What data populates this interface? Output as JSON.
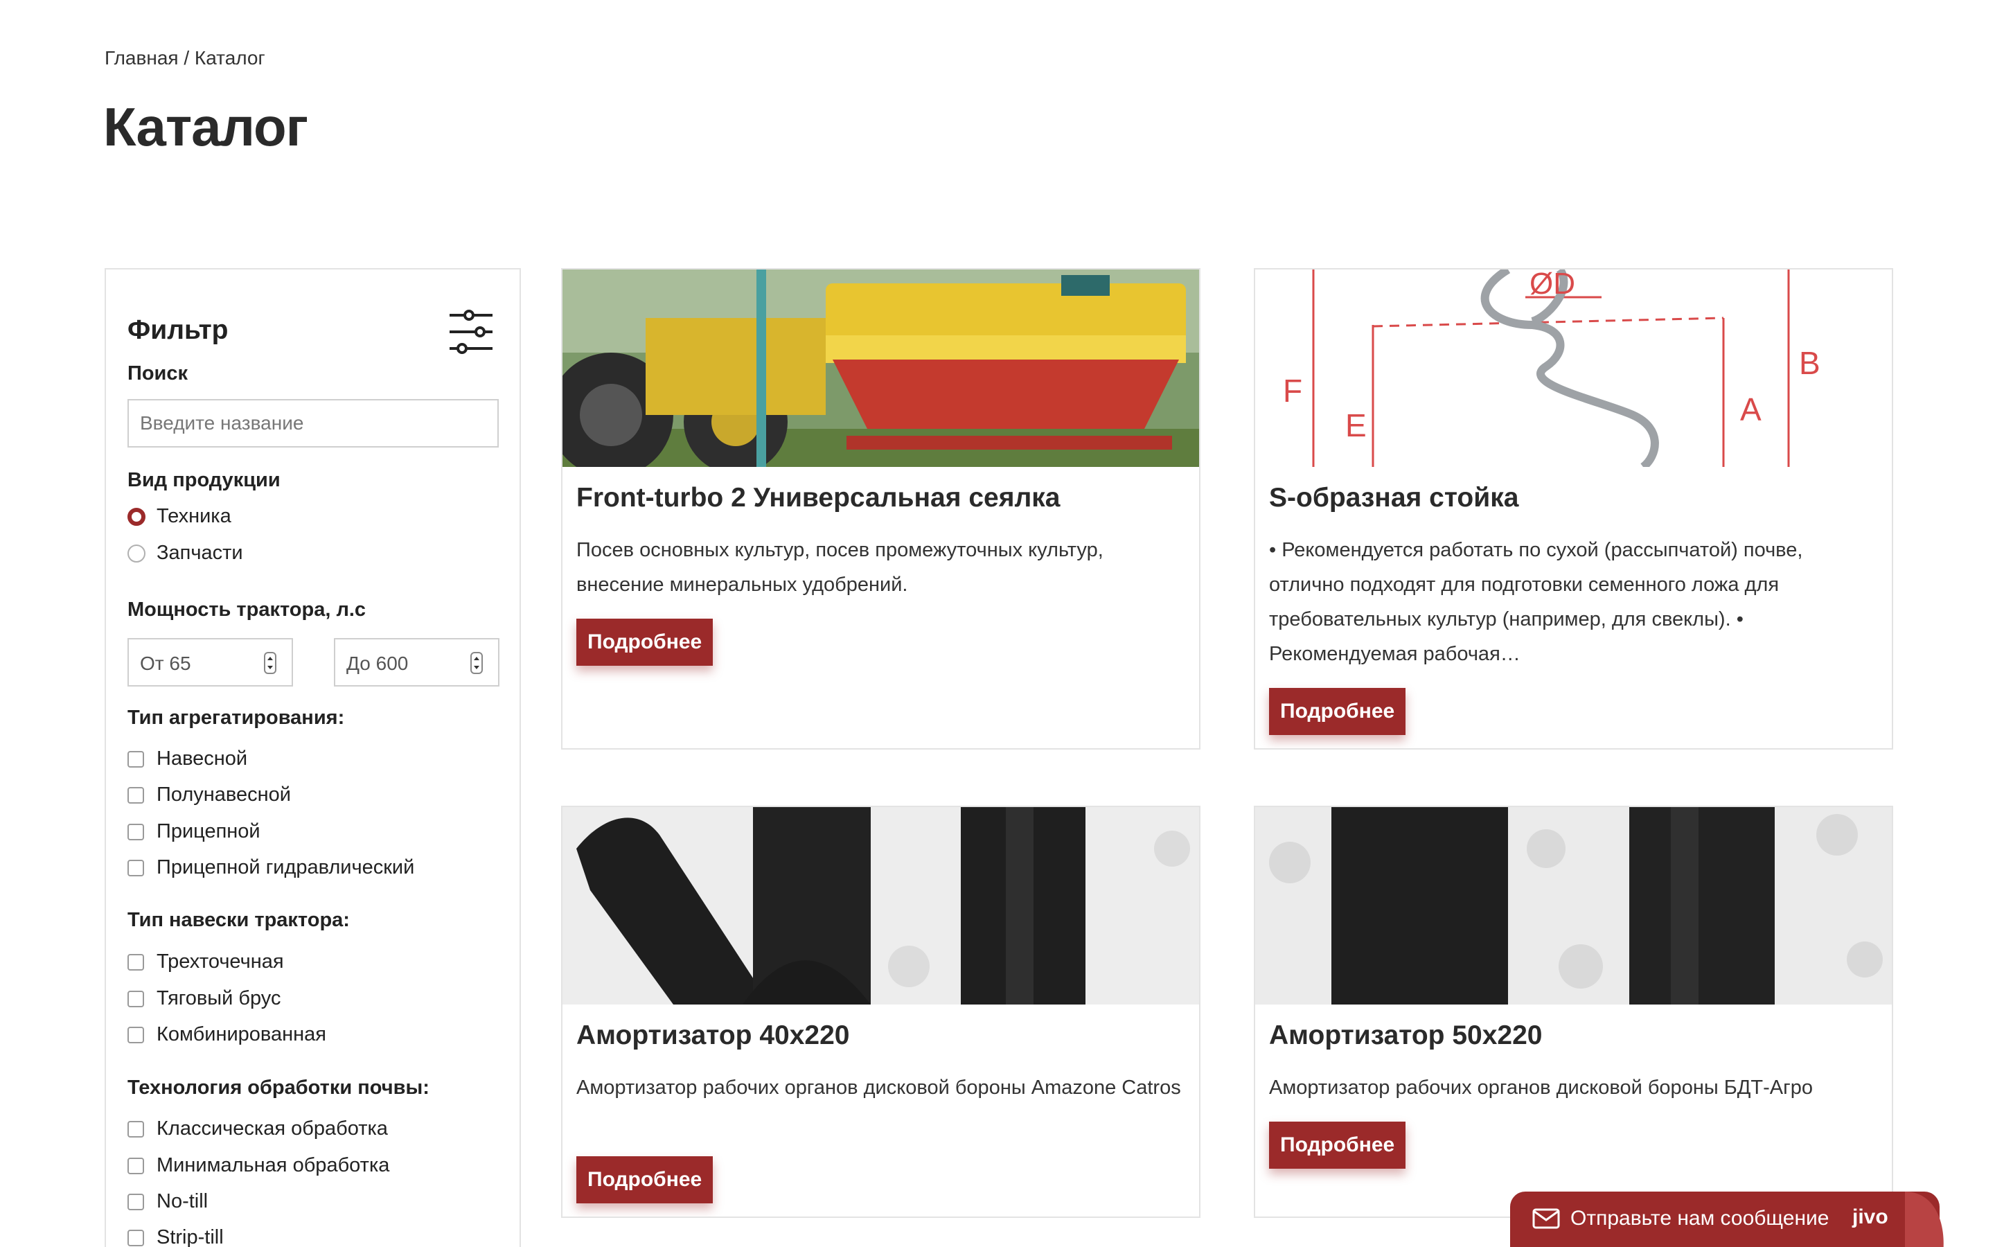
{
  "breadcrumb": "Главная / Каталог",
  "page_title": "Каталог",
  "filter": {
    "title": "Фильтр",
    "search_label": "Поиск",
    "search_placeholder": "Введите название",
    "product_type_label": "Вид продукции",
    "product_types": [
      {
        "label": "Техника",
        "selected": true
      },
      {
        "label": "Запчасти",
        "selected": false
      }
    ],
    "power_label": "Мощность трактора, л.с",
    "power_from": "От 65",
    "power_to": "До 600",
    "aggregation_label": "Тип агрегатирования:",
    "aggregation": [
      "Навесной",
      "Полунавесной",
      "Прицепной",
      "Прицепной гидравлический"
    ],
    "hitch_label": "Тип навески трактора:",
    "hitch": [
      "Трехточечная",
      "Тяговый брус",
      "Комбинированная"
    ],
    "tech_label": "Технология обработки почвы:",
    "tech": [
      "Классическая обработка",
      "Минимальная обработка",
      "No-till",
      "Strip-till"
    ]
  },
  "products": [
    {
      "title": "Front-turbo 2 Универсальная сеялка",
      "desc": "Посев основных культур, посев промежуточных культур, внесение минеральных удобрений.",
      "button": "Подробнее"
    },
    {
      "title": "S-образная стойка",
      "desc": "• Рекомендуется работать по сухой (рассыпчатой) почве, отлично подходят для подготовки семенного ложа для требовательных культур (например, для свеклы). • Рекомендуемая рабочая…",
      "button": "Подробнее",
      "diagram_labels": [
        "ØD",
        "F",
        "E",
        "A",
        "B"
      ]
    },
    {
      "title": "Амортизатор 40х220",
      "desc": "Амортизатор рабочих органов дисковой бороны Amazone Catros",
      "button": "Подробнее"
    },
    {
      "title": "Амортизатор 50х220",
      "desc": "Амортизатор рабочих органов дисковой бороны БДТ-Агро",
      "button": "Подробнее"
    }
  ],
  "chat": {
    "label": "Отправьте нам сообщение",
    "brand": "jivo"
  },
  "colors": {
    "accent": "#9b2a2a",
    "border": "#e3e3e3",
    "text": "#222222"
  }
}
